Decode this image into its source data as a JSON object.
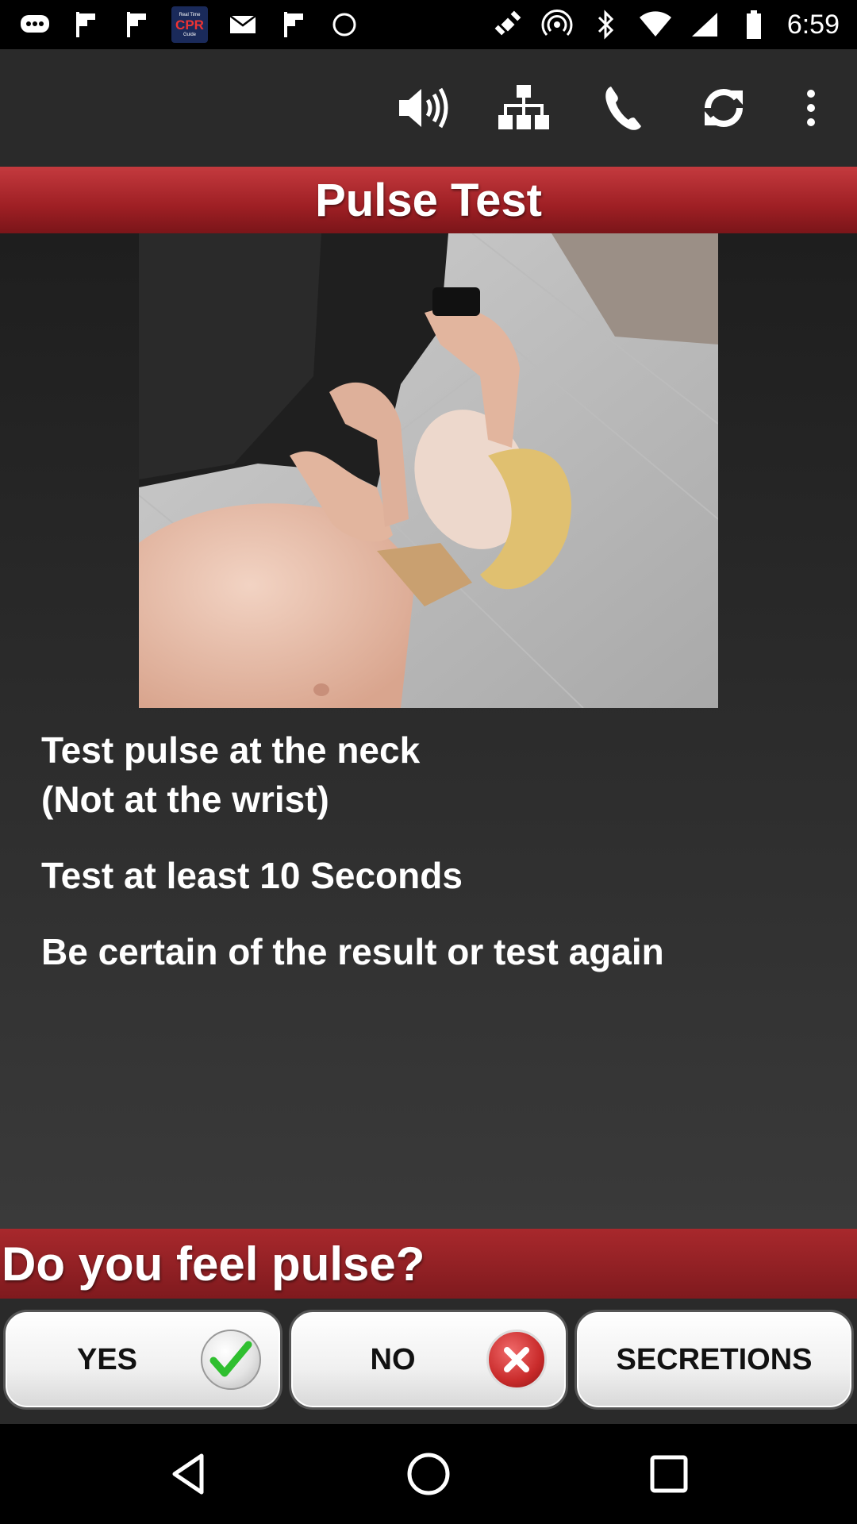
{
  "status_bar": {
    "time": "6:59",
    "cpr_badge_label": "CPR",
    "cpr_badge_small": "Real Time",
    "cpr_badge_small2": "Guide",
    "left_icons": [
      "messaging-icon",
      "flag-icon",
      "flag-icon",
      "cpr-app-icon",
      "mail-icon",
      "flag-icon",
      "circle-icon"
    ],
    "right_icons": [
      "fake-gps-satellite-icon",
      "hotspot-icon",
      "bluetooth-icon",
      "wifi-icon",
      "signal-icon",
      "battery-icon"
    ]
  },
  "toolbar": {
    "icons": [
      "volume-icon",
      "sitemap-icon",
      "phone-icon",
      "refresh-icon",
      "overflow-menu-icon"
    ]
  },
  "title": "Pulse Test",
  "image": {
    "description_icon": "cpr-pulse-check-photo"
  },
  "instructions": [
    "Test pulse at the neck\n(Not at the wrist)",
    "Test at least 10 Seconds",
    "Be certain of the result or test again"
  ],
  "question": "Do you feel pulse?",
  "answers": {
    "yes": "YES",
    "no": "NO",
    "secretions": "SECRETIONS"
  },
  "navigation": {
    "icons": [
      "back-icon",
      "home-icon",
      "recents-icon"
    ]
  },
  "colors": {
    "banner_red": "#9e1f24",
    "background": "#2a2a2a",
    "yes_check_green": "#2fbf2f",
    "no_x_red": "#c92b2b"
  }
}
